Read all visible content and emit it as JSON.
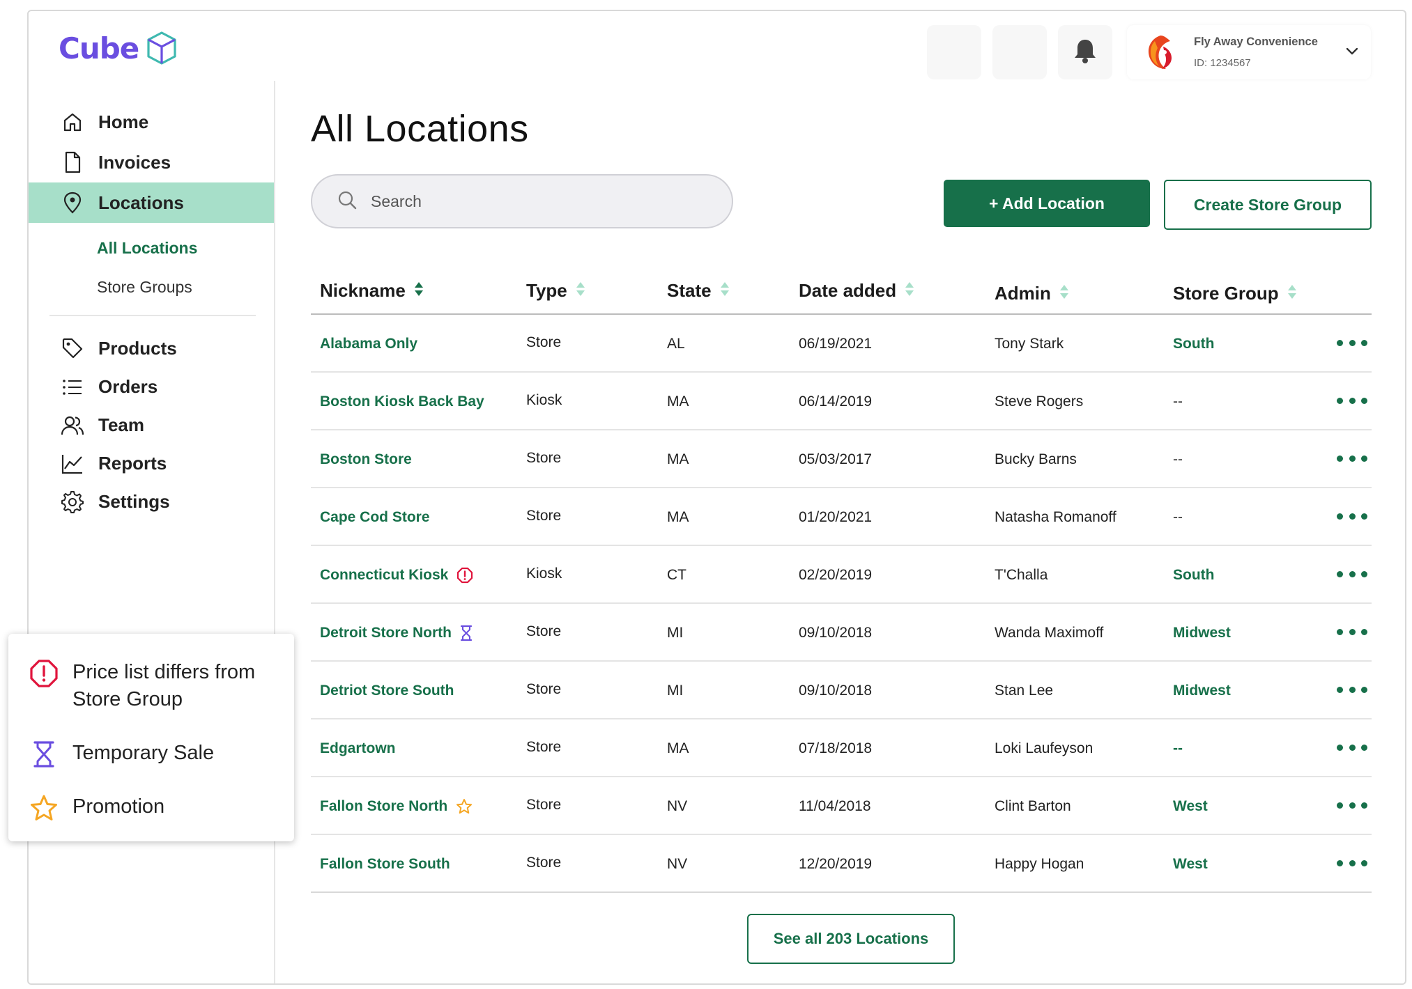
{
  "brand": {
    "name": "Cube"
  },
  "header": {
    "account": {
      "name": "Fly Away Convenience",
      "id": "ID: 1234567"
    }
  },
  "sidebar": {
    "items": [
      {
        "label": "Home",
        "icon": "home-icon"
      },
      {
        "label": "Invoices",
        "icon": "document-icon"
      },
      {
        "label": "Locations",
        "icon": "map-pin-icon",
        "active": true
      }
    ],
    "subitems": [
      {
        "label": "All Locations",
        "active": true
      },
      {
        "label": "Store Groups"
      }
    ],
    "items2": [
      {
        "label": "Products",
        "icon": "tag-icon"
      },
      {
        "label": "Orders",
        "icon": "list-icon"
      },
      {
        "label": "Team",
        "icon": "users-icon"
      },
      {
        "label": "Reports",
        "icon": "chart-line-icon"
      },
      {
        "label": "Settings",
        "icon": "gear-icon"
      }
    ]
  },
  "main": {
    "title": "All Locations",
    "search": {
      "placeholder": "Search"
    },
    "add_label": "+ Add Location",
    "create_label": "Create Store Group",
    "see_all_label": "See all 203 Locations"
  },
  "table": {
    "columns": [
      "Nickname",
      "Type",
      "State",
      "Date added",
      "Admin",
      "Store Group"
    ],
    "rows": [
      {
        "nickname": "Alabama Only",
        "badge": "",
        "type": "Store",
        "state": "AL",
        "date": "06/19/2021",
        "admin": "Tony Stark",
        "group": "South"
      },
      {
        "nickname": "Boston Kiosk Back Bay",
        "badge": "",
        "type": "Kiosk",
        "state": "MA",
        "date": "06/14/2019",
        "admin": "Steve Rogers",
        "group": "--"
      },
      {
        "nickname": "Boston Store",
        "badge": "",
        "type": "Store",
        "state": "MA",
        "date": "05/03/2017",
        "admin": "Bucky Barns",
        "group": "--"
      },
      {
        "nickname": "Cape Cod Store",
        "badge": "",
        "type": "Store",
        "state": "MA",
        "date": "01/20/2021",
        "admin": "Natasha Romanoff",
        "group": "--"
      },
      {
        "nickname": "Connecticut Kiosk",
        "badge": "alert",
        "type": "Kiosk",
        "state": "CT",
        "date": "02/20/2019",
        "admin": "T'Challa",
        "group": "South"
      },
      {
        "nickname": "Detroit Store North",
        "badge": "hourglass",
        "type": "Store",
        "state": "MI",
        "date": "09/10/2018",
        "admin": "Wanda Maximoff",
        "group": "Midwest"
      },
      {
        "nickname": "Detriot Store South",
        "badge": "",
        "type": "Store",
        "state": "MI",
        "date": "09/10/2018",
        "admin": "Stan Lee",
        "group": "Midwest"
      },
      {
        "nickname": "Edgartown",
        "badge": "",
        "type": "Store",
        "state": "MA",
        "date": "07/18/2018",
        "admin": "Loki Laufeyson",
        "group": "--",
        "group_green": true
      },
      {
        "nickname": "Fallon Store North",
        "badge": "star",
        "type": "Store",
        "state": "NV",
        "date": "11/04/2018",
        "admin": "Clint Barton",
        "group": "West"
      },
      {
        "nickname": "Fallon Store South",
        "badge": "",
        "type": "Store",
        "state": "NV",
        "date": "12/20/2019",
        "admin": "Happy Hogan",
        "group": "West"
      }
    ]
  },
  "legend": {
    "items": [
      {
        "label": "Price list differs from Store Group",
        "icon": "alert-octagon-icon",
        "color": "#e0143c"
      },
      {
        "label": "Temporary Sale",
        "icon": "hourglass-icon",
        "color": "#6a4ee0"
      },
      {
        "label": "Promotion",
        "icon": "star-icon",
        "color": "#f5a623"
      }
    ]
  },
  "colors": {
    "accent": "#17704a",
    "active_nav": "#a7dfc9",
    "brand": "#6a4ee0"
  }
}
